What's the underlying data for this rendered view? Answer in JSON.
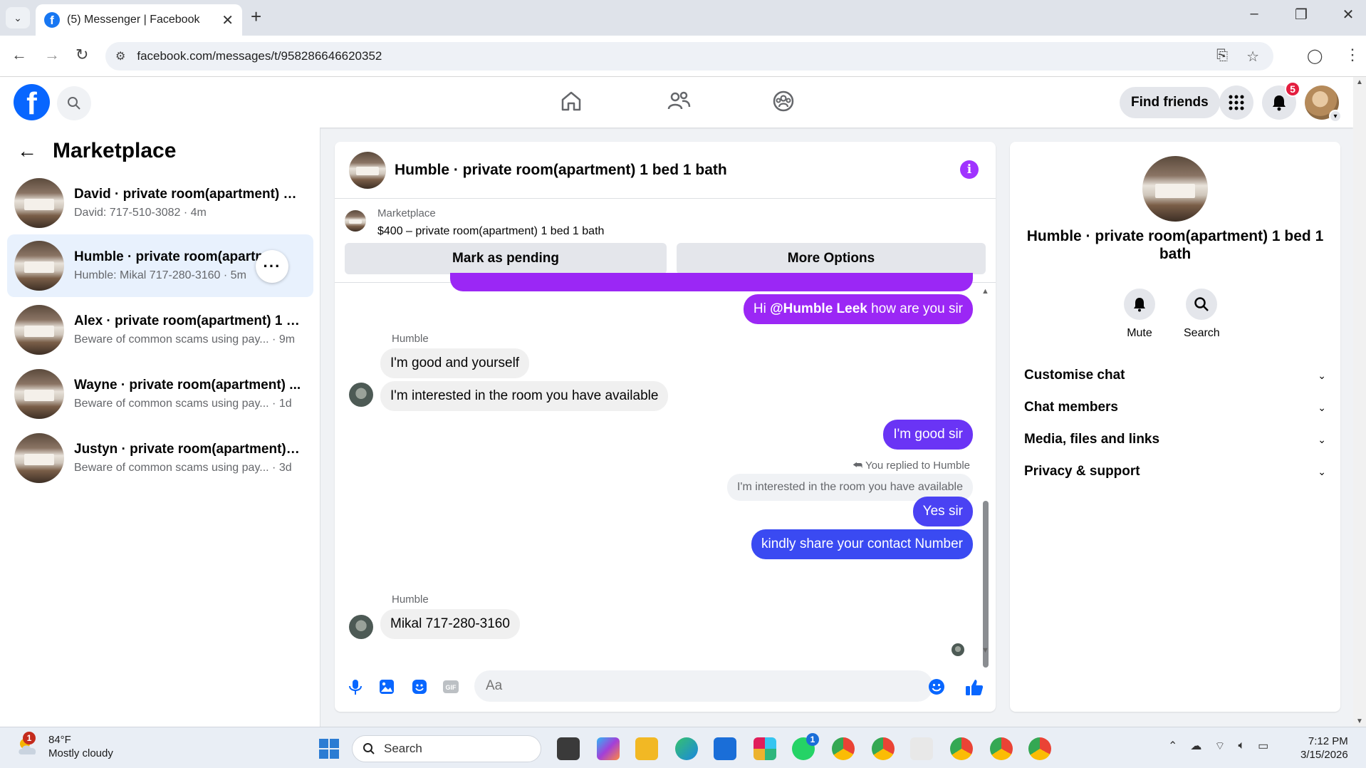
{
  "browser": {
    "tab_title": "(5) Messenger | Facebook",
    "url": "facebook.com/messages/t/958286646620352"
  },
  "header": {
    "find_friends": "Find friends",
    "notification_count": "5"
  },
  "left": {
    "title": "Marketplace",
    "conversations": [
      {
        "name": "David · private room(apartment) 1 ...",
        "sub": "David: 717-510-3082 · 4m"
      },
      {
        "name": "Humble · private room(apartm...",
        "sub": "Humble: Mikal 717-280-3160 · 5m"
      },
      {
        "name": "Alex · private room(apartment) 1 b...",
        "sub": "Beware of common scams using pay... · 9m"
      },
      {
        "name": "Wayne · private room(apartment) ...",
        "sub": "Beware of common scams using pay... · 1d"
      },
      {
        "name": "Justyn · private room(apartment) 1...",
        "sub": "Beware of common scams using pay... · 3d"
      }
    ],
    "more_icon": "···"
  },
  "chat": {
    "title": "Humble · private room(apartment) 1 bed 1 bath",
    "marketplace_label": "Marketplace",
    "listing": "$400 – private room(apartment) 1 bed 1 bath",
    "mark_pending": "Mark as pending",
    "more_options": "More Options",
    "messages": {
      "m1_prefix": "Hi ",
      "m1_mention": "@Humble Leek",
      "m1_suffix": " how are you sir",
      "sender1": "Humble",
      "m2": "I'm good and yourself",
      "m3": "I'm interested in the room you have available",
      "m4": "I'm good sir",
      "replied_label": "You replied to Humble",
      "quoted": "I'm interested in the room you have available",
      "m5": "Yes sir",
      "m6": "kindly share your contact Number",
      "sender2": "Humble",
      "m7": "Mikal 717-280-3160"
    },
    "composer_placeholder": "Aa"
  },
  "right": {
    "title": "Humble · private room(apartment) 1 bed 1 bath",
    "mute": "Mute",
    "search": "Search",
    "sections": [
      "Customise chat",
      "Chat members",
      "Media, files and links",
      "Privacy & support"
    ]
  },
  "taskbar": {
    "weather_temp": "84°F",
    "weather_desc": "Mostly cloudy",
    "weather_badge": "1",
    "search": "Search",
    "whatsapp_badge": "1",
    "time": "7:12 PM",
    "date": "3/15/2026"
  },
  "colors": {
    "fb_blue": "#0866ff",
    "msg_purple": "#9b27f5",
    "msg_blue": "#3a4af2"
  }
}
